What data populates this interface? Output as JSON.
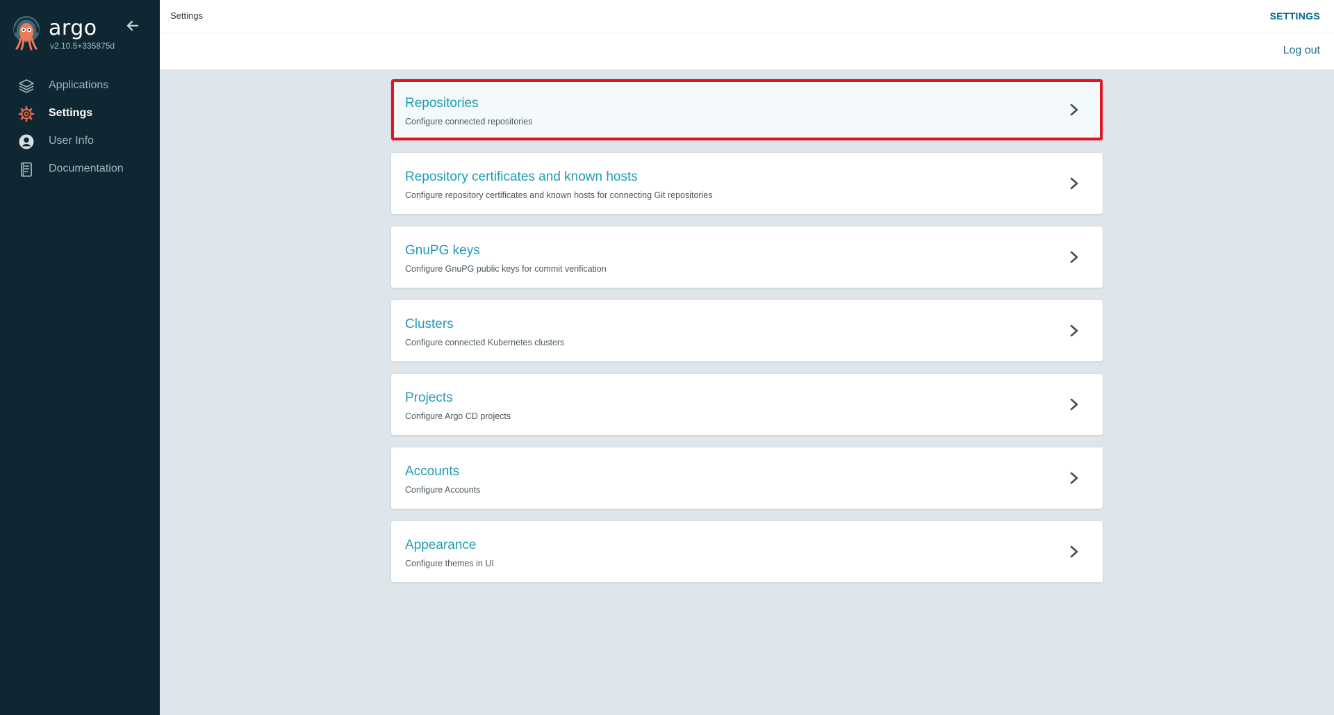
{
  "app": {
    "name": "argo",
    "version": "v2.10.5+335875d"
  },
  "sidebar": {
    "items": [
      {
        "label": "Applications",
        "icon": "layers-icon",
        "active": false
      },
      {
        "label": "Settings",
        "icon": "gear-icon",
        "active": true
      },
      {
        "label": "User Info",
        "icon": "user-circle-icon",
        "active": false
      },
      {
        "label": "Documentation",
        "icon": "book-icon",
        "active": false
      }
    ]
  },
  "header": {
    "breadcrumb": "Settings",
    "title": "SETTINGS",
    "logout_label": "Log out"
  },
  "settings": {
    "items": [
      {
        "title": "Repositories",
        "description": "Configure connected repositories",
        "highlighted": true
      },
      {
        "title": "Repository certificates and known hosts",
        "description": "Configure repository certificates and known hosts for connecting Git repositories",
        "highlighted": false
      },
      {
        "title": "GnuPG keys",
        "description": "Configure GnuPG public keys for commit verification",
        "highlighted": false
      },
      {
        "title": "Clusters",
        "description": "Configure connected Kubernetes clusters",
        "highlighted": false
      },
      {
        "title": "Projects",
        "description": "Configure Argo CD projects",
        "highlighted": false
      },
      {
        "title": "Accounts",
        "description": "Configure Accounts",
        "highlighted": false
      },
      {
        "title": "Appearance",
        "description": "Configure themes in UI",
        "highlighted": false
      }
    ]
  },
  "colors": {
    "sidebar_bg": "#0f2733",
    "accent": "#1e9bb5",
    "highlight_border": "#e3131f",
    "active_icon": "#e96d4c",
    "page_bg": "#dee6eb"
  }
}
